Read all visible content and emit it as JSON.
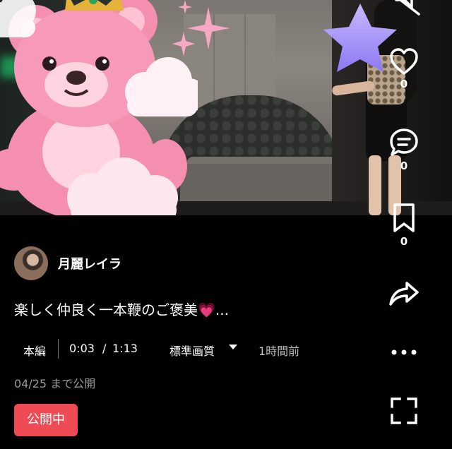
{
  "video": {
    "actions": {
      "like_count": "0",
      "comment_count": "0",
      "save_count": "0"
    },
    "icons": [
      "mute-icon",
      "heart-icon",
      "comment-icon",
      "bookmark-icon",
      "share-icon",
      "more-icon",
      "fullscreen-icon"
    ]
  },
  "creator": {
    "name": "月麗レイラ"
  },
  "post": {
    "caption_text": "楽しく仲良く一本鞭のご褒美",
    "caption_emoji": "💗",
    "caption_ellipsis": "..."
  },
  "player": {
    "segment_label": "本編",
    "time_current": "0:03",
    "time_separator": "/",
    "time_total": "1:13",
    "quality_label": "標準画質",
    "posted_ago": "1時間前"
  },
  "availability": {
    "date_text": "04/25 まで公開",
    "status_badge": "公開中"
  },
  "colors": {
    "badge_bg": "#ee4b54",
    "heart_emoji": "#ff59c1",
    "background": "#000000"
  }
}
